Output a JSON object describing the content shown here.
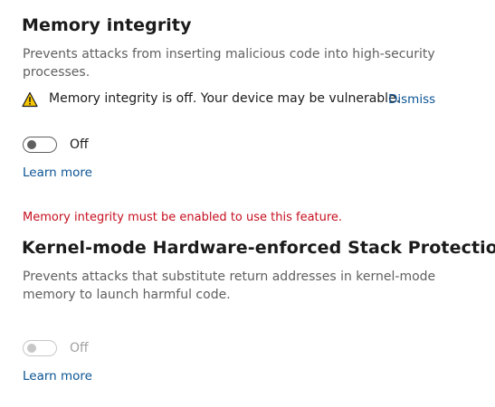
{
  "memory_integrity": {
    "title": "Memory integrity",
    "description": "Prevents attacks from inserting malicious code into high-security processes.",
    "warning": {
      "icon": "warning-triangle-icon",
      "text": "Memory integrity is off. Your device may be vulnerable.",
      "dismiss_label": "Dismiss"
    },
    "toggle": {
      "state_label": "Off",
      "on": false
    },
    "learn_more_label": "Learn more"
  },
  "stack_protection": {
    "error_text": "Memory integrity must be enabled to use this feature.",
    "title": "Kernel-mode Hardware-enforced Stack Protection",
    "description": "Prevents attacks that substitute return addresses in kernel-mode memory to launch harmful code.",
    "toggle": {
      "state_label": "Off",
      "on": false,
      "disabled": true
    },
    "learn_more_label": "Learn more"
  },
  "colors": {
    "link": "#0a5394",
    "error": "#c50f1f",
    "warning_fill": "#f7c600"
  }
}
